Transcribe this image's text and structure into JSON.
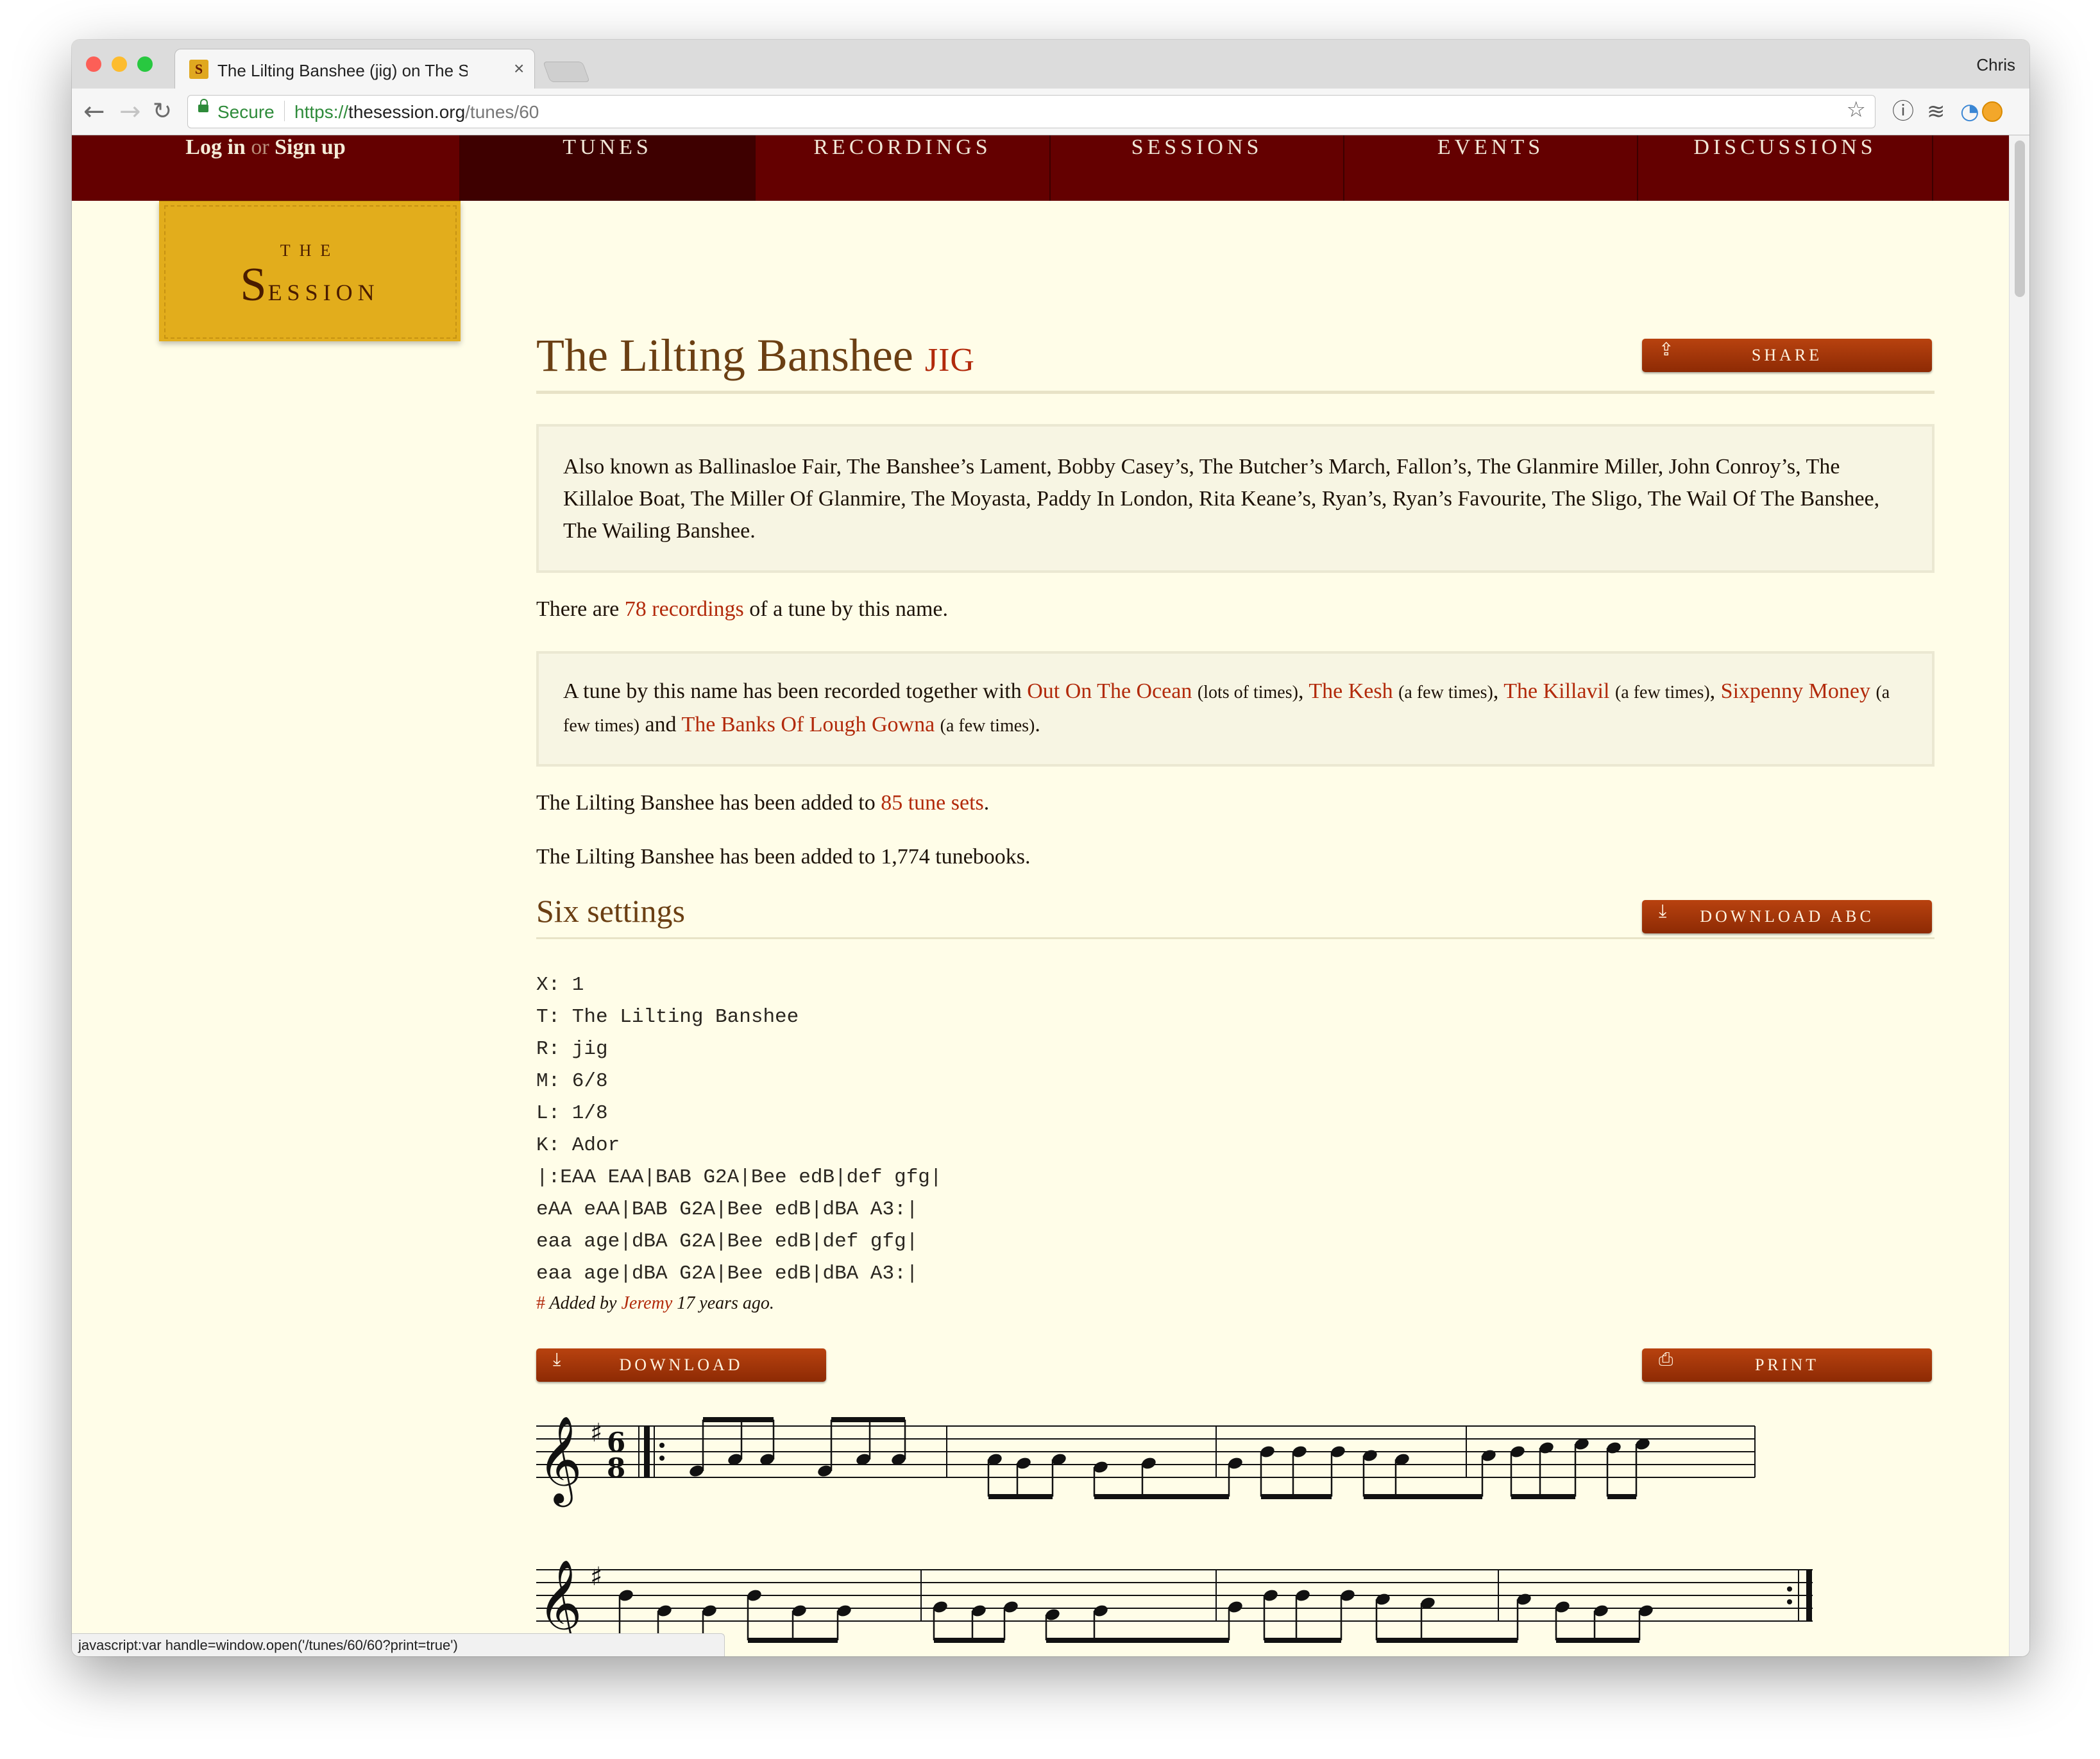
{
  "browser": {
    "tab_title": "The Lilting Banshee (jig) on The Session",
    "tab_close": "×",
    "profile_name": "Chris",
    "secure_label": "Secure",
    "url_protocol": "https://",
    "url_host": "thesession.org",
    "url_path": "/tunes/60",
    "status_bar_text": "javascript:var handle=window.open('/tunes/60/60?print=true')"
  },
  "nav": {
    "login": "Log in",
    "or": "or",
    "signup": "Sign up",
    "items": [
      "TUNES",
      "RECORDINGS",
      "SESSIONS",
      "EVENTS",
      "DISCUSSIONS"
    ],
    "active": "TUNES"
  },
  "logo": {
    "the": "THE",
    "session_initial": "S",
    "session_rest": "ESSION"
  },
  "tune": {
    "title": "The Lilting Banshee",
    "type": "JIG",
    "share_label": "SHARE",
    "aka_prefix": "Also known as",
    "aka_names": "Ballinasloe Fair, The Banshee’s Lament, Bobby Casey’s, The Butcher’s March, Fallon’s, The Glanmire Miller, John Conroy’s, The Killaloe Boat, The Miller Of Glanmire, The Moyasta, Paddy In London, Rita Keane’s, Ryan’s, Ryan’s Favourite, The Sligo, The Wail Of The Banshee, The Wailing Banshee.",
    "recordings_prefix": "There are",
    "recordings_link": "78 recordings",
    "recordings_suffix": "of a tune by this name.",
    "together_prefix": "A tune by this name has been recorded together with",
    "together": [
      {
        "name": "Out On The Ocean",
        "freq": "(lots of times)",
        "sep": ","
      },
      {
        "name": "The Kesh",
        "freq": "(a few times)",
        "sep": ","
      },
      {
        "name": "The Killavil",
        "freq": "(a few times)",
        "sep": ","
      },
      {
        "name": "Sixpenny Money",
        "freq": "(a few times)",
        "sep": " and"
      },
      {
        "name": "The Banks Of Lough Gowna",
        "freq": "(a few times)",
        "sep": "."
      }
    ],
    "sets_prefix": "The Lilting Banshee has been added to",
    "sets_link": "85 tune sets",
    "sets_suffix": ".",
    "tunebooks_text": "The Lilting Banshee has been added to 1,774 tunebooks."
  },
  "settings": {
    "heading": "Six settings",
    "download_abc_label": "DOWNLOAD ABC",
    "abc_lines": [
      "X: 1",
      "T: The Lilting Banshee",
      "R: jig",
      "M: 6/8",
      "L: 1/8",
      "K: Ador",
      "|:EAA EAA|BAB G2A|Bee edB|def gfg|",
      "eAA eAA|BAB G2A|Bee edB|dBA A3:|",
      "eaa age|dBA G2A|Bee edB|def gfg|",
      "eaa age|dBA G2A|Bee edB|dBA A3:|"
    ],
    "added_hash": "#",
    "added_by_prefix": "Added by",
    "added_by_user": "Jeremy",
    "added_ago": "17 years ago.",
    "download_label": "DOWNLOAD",
    "print_label": "PRINT",
    "time_signature": {
      "top": "6",
      "bottom": "8"
    },
    "key_signature": "♯"
  },
  "colors": {
    "nav_bg": "#640000",
    "accent": "#b22a0b",
    "page_bg": "#fffde8",
    "logo": "#e2ad1c"
  }
}
